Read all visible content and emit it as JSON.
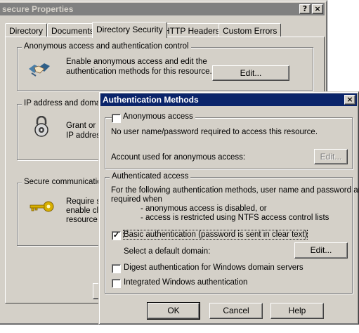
{
  "properties": {
    "title": "secure Properties",
    "help_btn": "?",
    "close_btn": "×",
    "tabs": [
      "Directory",
      "Documents",
      "Directory Security",
      "HTTP Headers",
      "Custom Errors"
    ],
    "anon_group": {
      "legend": "Anonymous access and authentication control",
      "desc_line1": "Enable anonymous access and edit the",
      "desc_line2": "authentication methods for this resource.",
      "edit_label": "Edit..."
    },
    "ip_group": {
      "legend": "IP address and domain",
      "desc_line1": "Grant or",
      "desc_line2": "IP addres"
    },
    "secure_group": {
      "legend": "Secure communication",
      "desc_line1": "Require s",
      "desc_line2": "enable cl",
      "desc_line3": "resource"
    }
  },
  "auth_dialog": {
    "title": "Authentication Methods",
    "close_btn": "×",
    "anonymous": {
      "label": "Anonymous access",
      "checked": false,
      "desc": "No user name/password required to access this resource.",
      "account_label": "Account used for anonymous access:",
      "edit_label": "Edit..."
    },
    "authenticated": {
      "legend": "Authenticated access",
      "desc_line1": "For the following authentication methods, user name and password are",
      "desc_line2": "required when",
      "bullet1": "- anonymous access is disabled, or",
      "bullet2": "- access is restricted using NTFS access control lists",
      "basic_label": "Basic authentication (password is sent in clear text)",
      "basic_checked": "✓",
      "domain_label": "Select a default domain:",
      "domain_edit_label": "Edit...",
      "digest_label": "Digest authentication for Windows domain servers",
      "integrated_label": "Integrated Windows authentication"
    },
    "ok_label": "OK",
    "cancel_label": "Cancel",
    "help_label": "Help"
  }
}
